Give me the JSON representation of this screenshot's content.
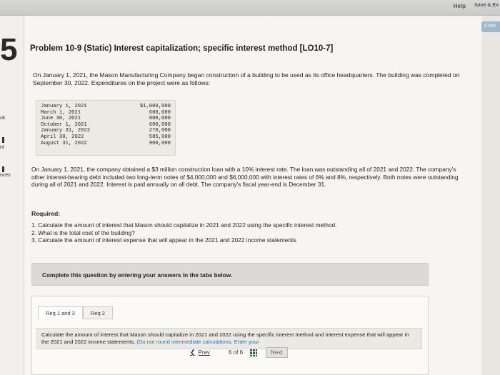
{
  "topbar": {
    "help": "Help",
    "save_exit": "Save & Ex"
  },
  "check_button": "Chec",
  "sidebar": {
    "labels": [
      "ok",
      "nt",
      "nces"
    ]
  },
  "problem": {
    "title": "Problem 10-9 (Static) Interest capitalization; specific interest method [LO10-7]",
    "intro": "On January 1, 2021, the Mason Manufacturing Company began construction of a building to be used as its office headquarters. The building was completed on September 30, 2022. Expenditures on the project were as follows:",
    "expenditures": [
      {
        "date": "January 1, 2021",
        "amount": "$1,000,000"
      },
      {
        "date": "March 1, 2021",
        "amount": "600,000"
      },
      {
        "date": "June 30, 2021",
        "amount": "800,000"
      },
      {
        "date": "October 1, 2021",
        "amount": "600,000"
      },
      {
        "date": "January 31, 2022",
        "amount": "270,000"
      },
      {
        "date": "April 30, 2022",
        "amount": "585,000"
      },
      {
        "date": "August 31, 2022",
        "amount": "900,000"
      }
    ],
    "loan_text": "On January 1, 2021, the company obtained a $3 million construction loan with a 10% interest rate. The loan was outstanding all of 2021 and 2022. The company's other interest-bearing debt included two long-term notes of $4,000,000 and $6,000,000 with interest rates of 6% and 8%, respectively. Both notes were outstanding during all of 2021 and 2022. Interest is paid annually on all debt. The company's fiscal year-end is December 31.",
    "required_heading": "Required:",
    "required_items": [
      "1. Calculate the amount of interest that Mason should capitalize in 2021 and 2022 using the specific interest method.",
      "2. What is the total cost of the building?",
      "3. Calculate the amount of interest expense that will appear in the 2021 and 2022 income statements."
    ]
  },
  "complete_bar": "Complete this question by entering your answers in the tabs below.",
  "tabs": [
    {
      "label": "Req 1 and 3"
    },
    {
      "label": "Req 2"
    }
  ],
  "instructions": {
    "main": "Calculate the amount of interest that Mason should capitalize in 2021 and 2022 using the specific interest method and interest expense that will appear in the 2021 and 2022 income statements.",
    "note": "(Do not round intermediate calculations. Enter your"
  },
  "pager": {
    "prev": "Prev",
    "page": "6",
    "of": "of",
    "total": "6",
    "next": "Next"
  }
}
